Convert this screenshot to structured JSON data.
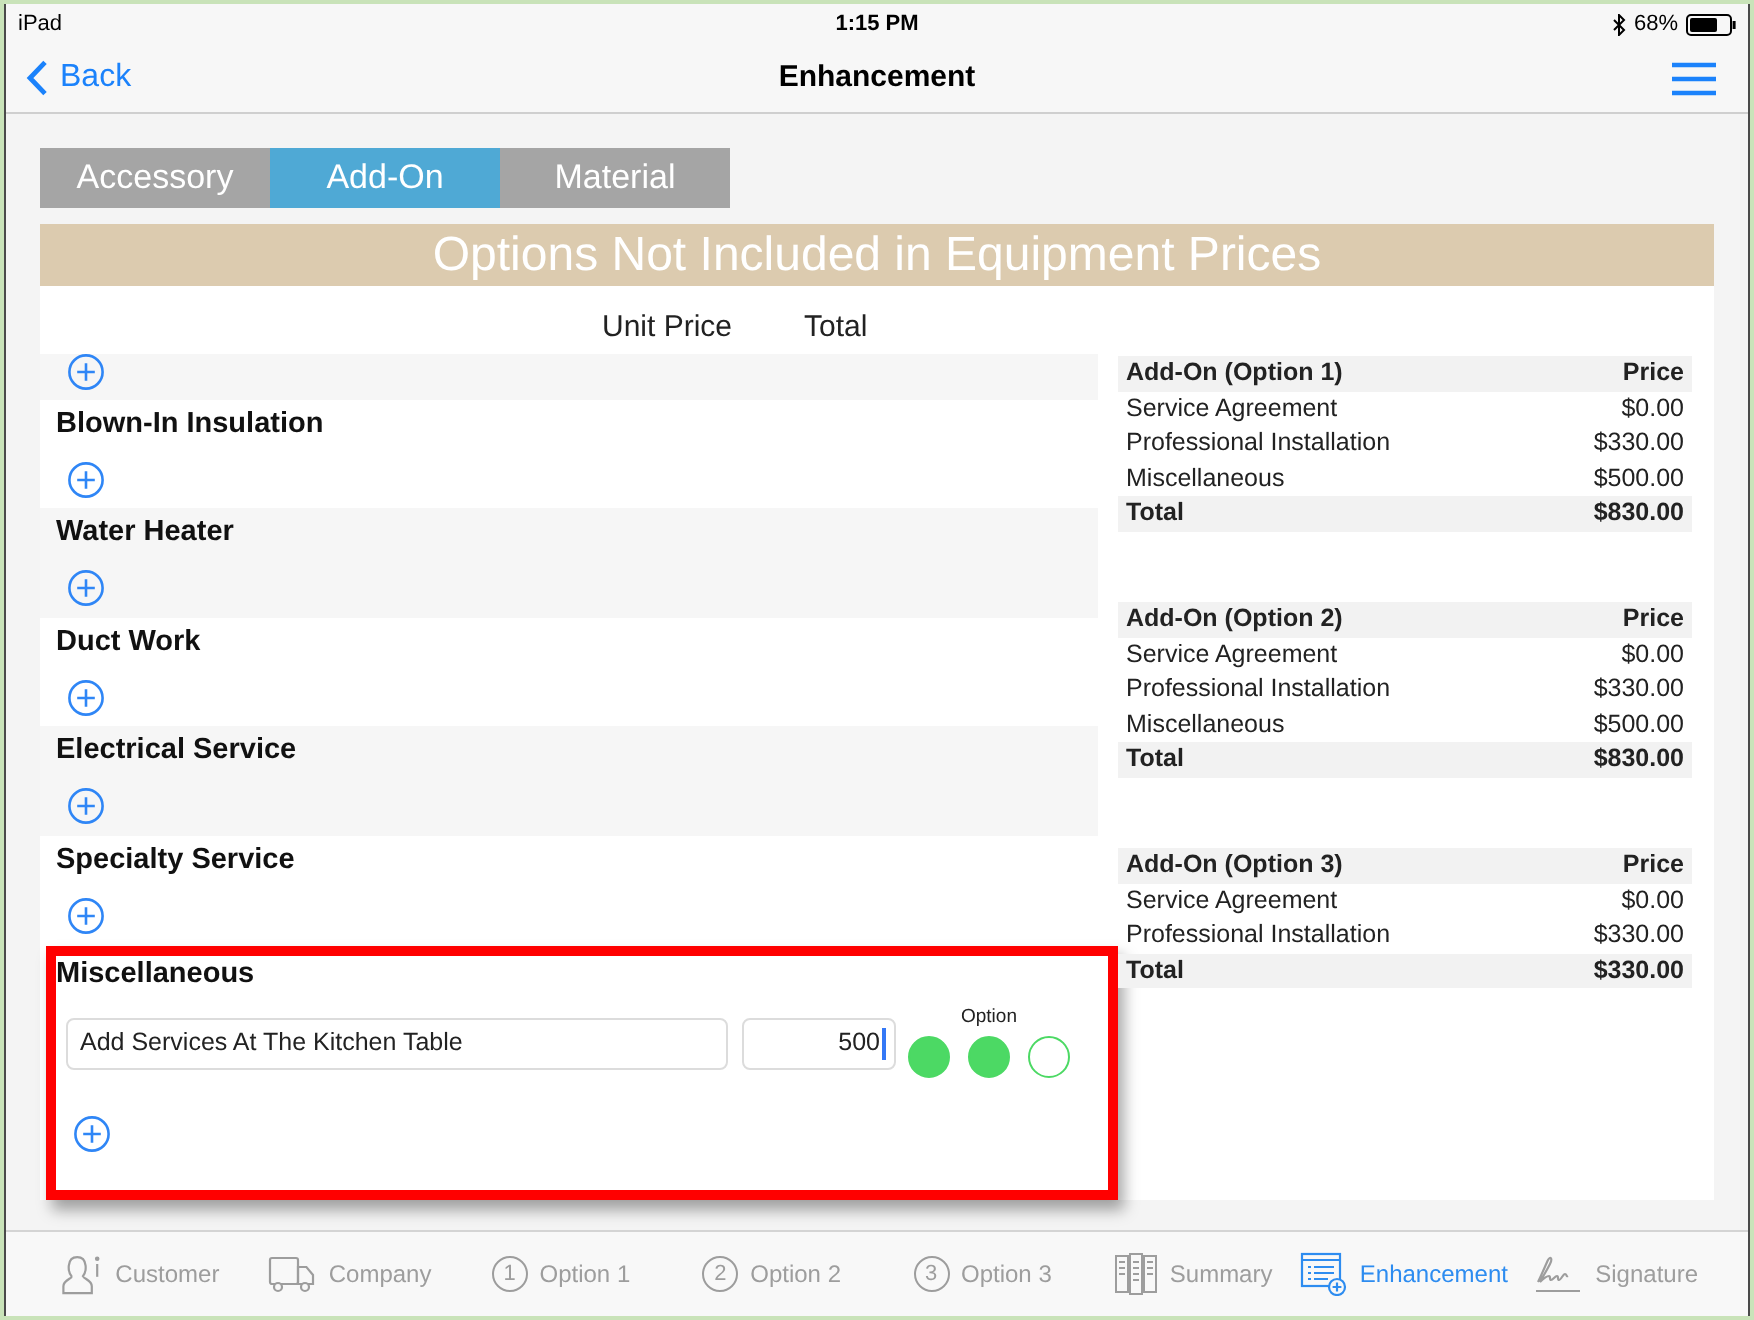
{
  "status_bar": {
    "device": "iPad",
    "time": "1:15 PM",
    "battery": "68%"
  },
  "nav_bar": {
    "back": "Back",
    "title": "Enhancement"
  },
  "tabs": [
    {
      "label": "Accessory",
      "selected": false
    },
    {
      "label": "Add-On",
      "selected": true
    },
    {
      "label": "Material",
      "selected": false
    }
  ],
  "banner": "Options Not Included in Equipment Prices",
  "columns": [
    "Unit Price",
    "Total"
  ],
  "sections": [
    {
      "title": "Blown-In Insulation",
      "highlighted": false
    },
    {
      "title": "Water Heater",
      "highlighted": false
    },
    {
      "title": "Duct Work",
      "highlighted": false
    },
    {
      "title": "Electrical Service",
      "highlighted": false
    },
    {
      "title": "Specialty Service",
      "highlighted": false
    },
    {
      "title": "Miscellaneous",
      "highlighted": true,
      "items": [
        {
          "description": "Add Services At The Kitchen Table",
          "price": "500",
          "price_focused": true,
          "options_label": "Option",
          "options": [
            {
              "checked": true
            },
            {
              "checked": true
            },
            {
              "checked": false
            }
          ]
        }
      ]
    }
  ],
  "summaries": [
    {
      "title": "Add-On (Option 1)",
      "price_heading": "Price",
      "rows": [
        {
          "label": "Service Agreement",
          "price": "$0.00"
        },
        {
          "label": "Professional Installation",
          "price": "$330.00"
        },
        {
          "label": "Miscellaneous",
          "price": "$500.00"
        }
      ],
      "total": {
        "label": "Total",
        "price": "$830.00"
      }
    },
    {
      "title": "Add-On (Option 2)",
      "price_heading": "Price",
      "rows": [
        {
          "label": "Service Agreement",
          "price": "$0.00"
        },
        {
          "label": "Professional Installation",
          "price": "$330.00"
        },
        {
          "label": "Miscellaneous",
          "price": "$500.00"
        }
      ],
      "total": {
        "label": "Total",
        "price": "$830.00"
      }
    },
    {
      "title": "Add-On (Option 3)",
      "price_heading": "Price",
      "rows": [
        {
          "label": "Service Agreement",
          "price": "$0.00"
        },
        {
          "label": "Professional Installation",
          "price": "$330.00"
        }
      ],
      "total": {
        "label": "Total",
        "price": "$330.00"
      }
    }
  ],
  "bottom_tabs": [
    {
      "kind": "person",
      "label": "Customer",
      "selected": false
    },
    {
      "kind": "truck",
      "label": "Company",
      "selected": false
    },
    {
      "kind": "numbered",
      "number": "1",
      "label": "Option 1",
      "selected": false
    },
    {
      "kind": "numbered",
      "number": "2",
      "label": "Option 2",
      "selected": false
    },
    {
      "kind": "numbered",
      "number": "3",
      "label": "Option 3",
      "selected": false
    },
    {
      "kind": "columns",
      "label": "Summary",
      "selected": false
    },
    {
      "kind": "document",
      "label": "Enhancement",
      "selected": true
    },
    {
      "kind": "signature",
      "label": "Signature",
      "selected": false
    }
  ]
}
